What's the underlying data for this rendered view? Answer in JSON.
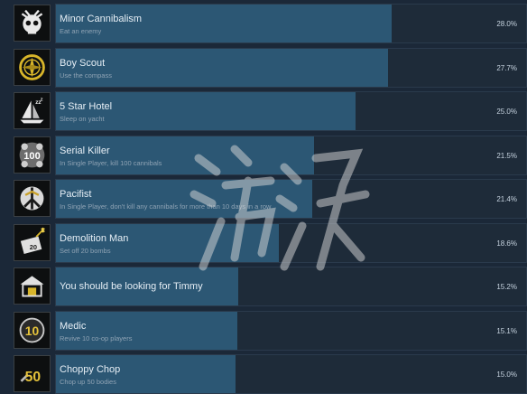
{
  "achievements": [
    {
      "name": "Minor Cannibalism",
      "desc": "Eat an enemy",
      "pct": "28.0%",
      "fill": 0.28,
      "icon": "skull-icon"
    },
    {
      "name": "Boy Scout",
      "desc": "Use the compass",
      "pct": "27.7%",
      "fill": 0.277,
      "icon": "compass-icon"
    },
    {
      "name": "5 Star Hotel",
      "desc": "Sleep on yacht",
      "pct": "25.0%",
      "fill": 0.25,
      "icon": "yacht-sleep-icon"
    },
    {
      "name": "Serial Killer",
      "desc": "In Single Player, kill 100 cannibals",
      "pct": "21.5%",
      "fill": 0.215,
      "icon": "skulls-100-icon"
    },
    {
      "name": "Pacifist",
      "desc": "In Single Player, don't kill any cannibals for more than 10 days in a row",
      "pct": "21.4%",
      "fill": 0.214,
      "icon": "peace-icon"
    },
    {
      "name": "Demolition Man",
      "desc": "Set off 20 bombs",
      "pct": "18.6%",
      "fill": 0.186,
      "icon": "bomb-icon"
    },
    {
      "name": "You should be looking for Timmy",
      "desc": "",
      "pct": "15.2%",
      "fill": 0.152,
      "icon": "shelter-icon"
    },
    {
      "name": "Medic",
      "desc": "Revive 10 co-op players",
      "pct": "15.1%",
      "fill": 0.151,
      "icon": "medic-10-icon"
    },
    {
      "name": "Choppy Chop",
      "desc": "Chop up 50 bodies",
      "pct": "15.0%",
      "fill": 0.15,
      "icon": "chop-50-icon"
    }
  ],
  "colors": {
    "background": "#1b2838",
    "bar": "#2c5774",
    "track": "#1e2b39"
  },
  "watermark": {
    "icon": "watermark-icon"
  }
}
